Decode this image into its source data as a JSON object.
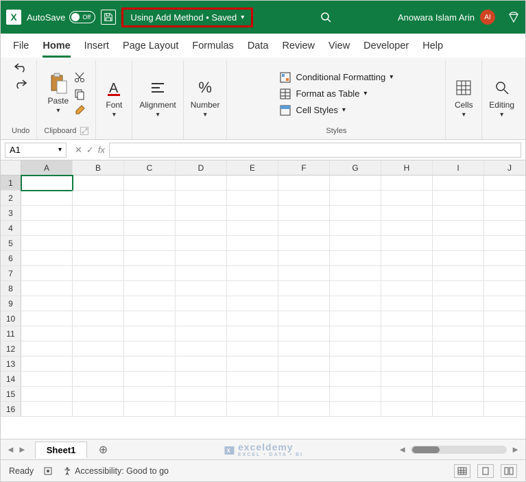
{
  "titlebar": {
    "autosave_label": "AutoSave",
    "autosave_state": "Off",
    "file_title": "Using Add Method • Saved",
    "username": "Anowara Islam Arin",
    "avatar_initials": "AI"
  },
  "tabs": [
    "File",
    "Home",
    "Insert",
    "Page Layout",
    "Formulas",
    "Data",
    "Review",
    "View",
    "Developer",
    "Help"
  ],
  "active_tab": "Home",
  "ribbon": {
    "undo_label": "Undo",
    "clipboard_label": "Clipboard",
    "paste_label": "Paste",
    "font_label": "Font",
    "alignment_label": "Alignment",
    "number_label": "Number",
    "styles_label": "Styles",
    "cond_fmt": "Conditional Formatting",
    "fmt_table": "Format as Table",
    "cell_styles": "Cell Styles",
    "cells_label": "Cells",
    "editing_label": "Editing"
  },
  "formula_bar": {
    "name_box": "A1",
    "fx_label": "fx",
    "value": ""
  },
  "grid": {
    "columns": [
      "A",
      "B",
      "C",
      "D",
      "E",
      "F",
      "G",
      "H",
      "I",
      "J"
    ],
    "rows": [
      "1",
      "2",
      "3",
      "4",
      "5",
      "6",
      "7",
      "8",
      "9",
      "10",
      "11",
      "12",
      "13",
      "14",
      "15",
      "16"
    ],
    "active_cell": "A1"
  },
  "sheet_tabs": {
    "active": "Sheet1"
  },
  "watermark": {
    "brand": "exceldemy",
    "tagline": "EXCEL • DATA • BI"
  },
  "statusbar": {
    "ready": "Ready",
    "accessibility": "Accessibility: Good to go"
  }
}
